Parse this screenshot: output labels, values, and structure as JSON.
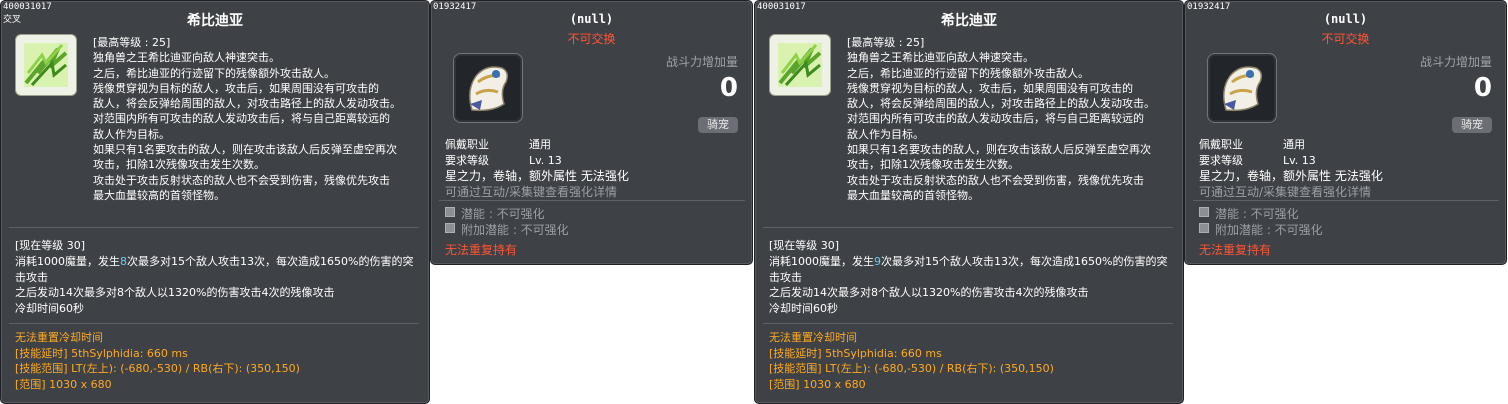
{
  "skill_cards": [
    {
      "code": "400031017",
      "subcode": "交叉",
      "title": "希比迪亚",
      "desc_lines": [
        "[最高等级 : 25]",
        "独角兽之王希比迪亚向敌人神速突击。",
        "之后，希比迪亚的行迹留下的残像额外攻击敌人。",
        "残像贯穿视为目标的敌人，攻击后，如果周围没有可攻击的",
        "敌人，将会反弹给周围的敌人，对攻击路径上的敌人发动攻击。",
        "对范围内所有可攻击的敌人发动攻击后，将与自己距离较远的",
        "敌人作为目标。",
        "如果只有1名要攻击的敌人，则在攻击该敌人后反弹至虚空再次",
        "攻击，扣除1次残像攻击发生次数。",
        "攻击处于攻击反射状态的敌人也不会受到伤害，残像优先攻击",
        "最大血量较高的首领怪物。"
      ],
      "level_header": "[现在等级 30]",
      "level_pre": "消耗1000魔量，发生",
      "level_hl": "8",
      "level_post": "次最多对15个敌人攻击13次，每次造成1650%的伤害的突",
      "level_lines": [
        "击攻击",
        "之后发动14次最多对8个敌人以1320%的伤害攻击4次的残像攻击",
        "冷却时间60秒"
      ],
      "orange_lines": [
        "无法重置冷却时间",
        "[技能延时] 5thSylphidia: 660 ms",
        "[技能范围] LT(左上): (-680,-530) / RB(右下): (350,150)",
        "[范围] 1030 x 680"
      ]
    },
    {
      "code": "400031017",
      "subcode": "",
      "title": "希比迪亚",
      "desc_lines": [
        "[最高等级 : 25]",
        "独角兽之王希比迪亚向敌人神速突击。",
        "之后，希比迪亚的行迹留下的残像额外攻击敌人。",
        "残像贯穿视为目标的敌人，攻击后，如果周围没有可攻击的",
        "敌人，将会反弹给周围的敌人，对攻击路径上的敌人发动攻击。",
        "对范围内所有可攻击的敌人发动攻击后，将与自己距离较远的",
        "敌人作为目标。",
        "如果只有1名要攻击的敌人，则在攻击该敌人后反弹至虚空再次",
        "攻击，扣除1次残像攻击发生次数。",
        "攻击处于攻击反射状态的敌人也不会受到伤害，残像优先攻击",
        "最大血量较高的首领怪物。"
      ],
      "level_header": "[现在等级 30]",
      "level_pre": "消耗1000魔量，发生",
      "level_hl": "9",
      "level_post": "次最多对15个敌人攻击13次，每次造成1650%的伤害的突",
      "level_lines": [
        "击攻击",
        "之后发动14次最多对8个敌人以1320%的伤害攻击4次的残像攻击",
        "冷却时间60秒"
      ],
      "orange_lines": [
        "无法重置冷却时间",
        "[技能延时] 5thSylphidia: 660 ms",
        "[技能范围] LT(左上): (-680,-530) / RB(右下): (350,150)",
        "[范围] 1030 x 680"
      ]
    }
  ],
  "item_cards": [
    {
      "code": "01932417",
      "title": "(null)",
      "trade": "不可交换",
      "power_label": "战斗力增加量",
      "power_value": "0",
      "badge": "骑宠",
      "job_label": "佩戴职业",
      "job_value": "通用",
      "req_label": "要求等级",
      "req_value": "Lv. 13",
      "props": "星之力，卷轴，额外属性 无法强化",
      "hint": "可通过互动/采集键查看强化详情",
      "potential": "潜能 : 不可强化",
      "add_potential": "附加潜能 : 不可强化",
      "no_dup": "无法重复持有"
    },
    {
      "code": "01932417",
      "title": "(null)",
      "trade": "不可交换",
      "power_label": "战斗力增加量",
      "power_value": "0",
      "badge": "骑宠",
      "job_label": "佩戴职业",
      "job_value": "通用",
      "req_label": "要求等级",
      "req_value": "Lv. 13",
      "props": "星之力，卷轴，额外属性 无法强化",
      "hint": "可通过互动/采集键查看强化详情",
      "potential": "潜能 : 不可强化",
      "add_potential": "附加潜能 : 不可强化",
      "no_dup": "无法重复持有"
    }
  ]
}
